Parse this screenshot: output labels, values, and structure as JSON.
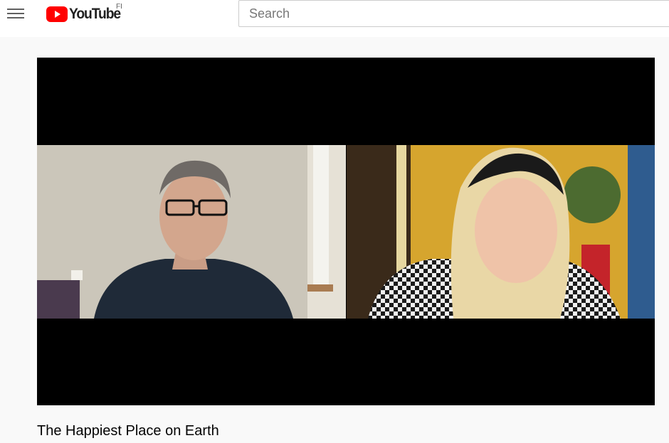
{
  "header": {
    "menu_icon": "hamburger-menu-icon",
    "logo_text": "YouTube",
    "logo_country": "FI",
    "search_placeholder": "Search"
  },
  "video": {
    "title": "The Happiest Place on Earth"
  },
  "colors": {
    "brand_red": "#ff0000",
    "background": "#f9f9f9",
    "text": "#030303"
  }
}
